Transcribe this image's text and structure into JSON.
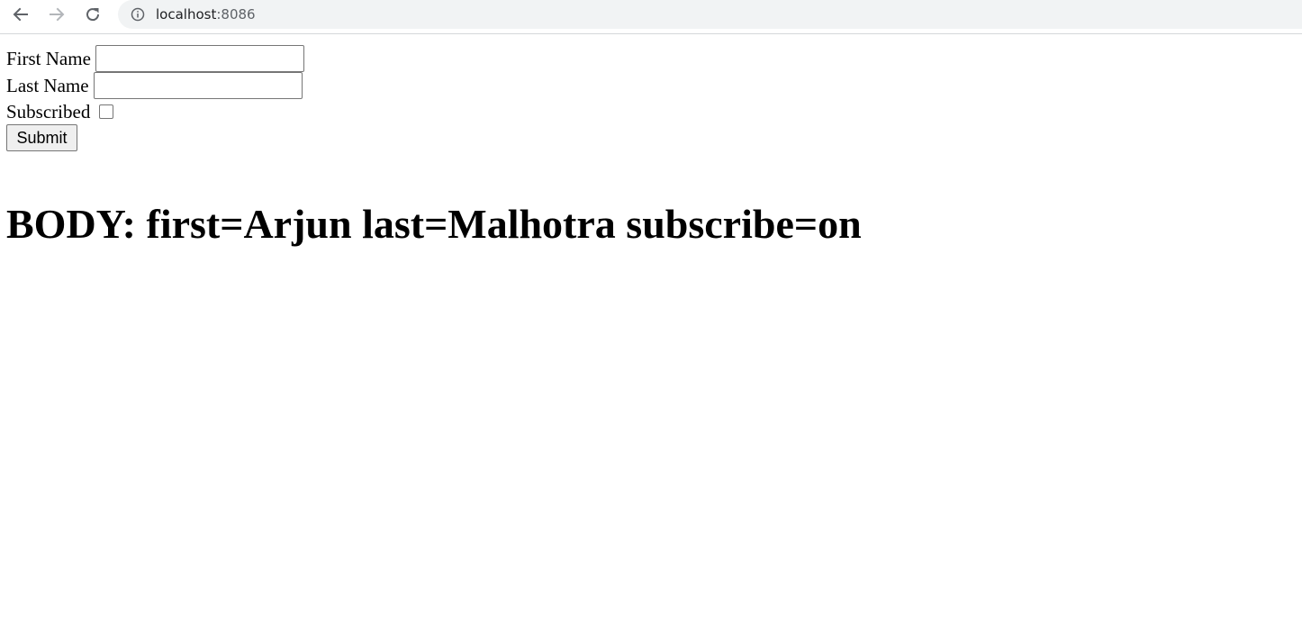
{
  "browser": {
    "url_host": "localhost",
    "url_port": ":8086",
    "icons": {
      "back": "arrow-left-icon",
      "forward": "arrow-right-icon",
      "reload": "reload-icon",
      "site_info": "info-circle-icon"
    }
  },
  "form": {
    "first_name_label": "First Name",
    "first_name_value": "",
    "last_name_label": "Last Name",
    "last_name_value": "",
    "subscribed_label": "Subscribed",
    "subscribed_checked": false,
    "submit_label": "Submit"
  },
  "result": {
    "text": "BODY: first=Arjun last=Malhotra subscribe=on"
  }
}
